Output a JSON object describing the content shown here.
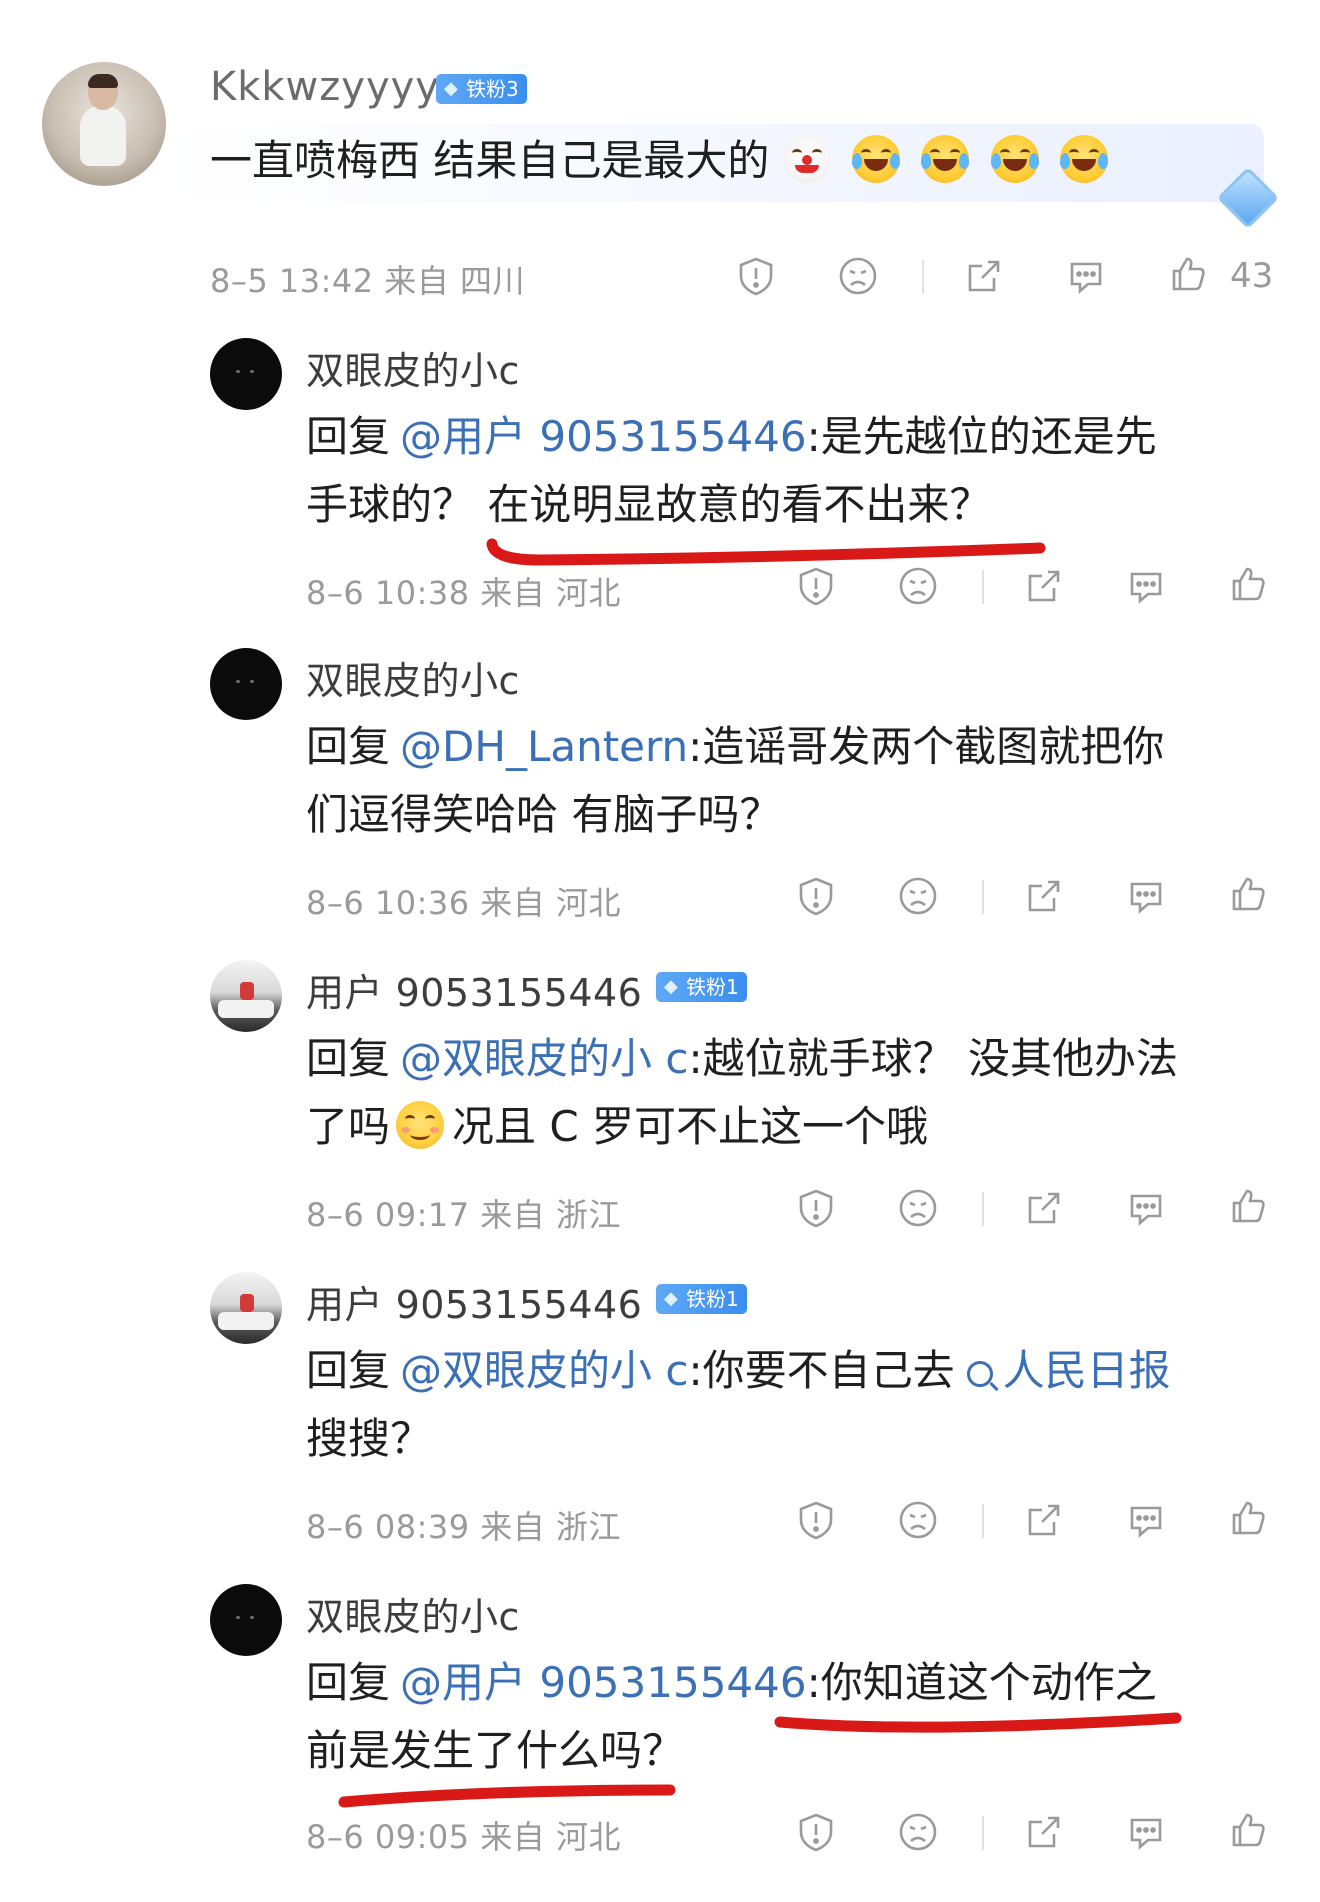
{
  "post": {
    "author": "Kkkwzyyyy",
    "badge": "铁粉3",
    "text": "一直喷梅西 结果自己是最大的",
    "meta": "8–5 13:42 来自 四川",
    "likes": "43",
    "emojis": [
      "clown-face-emoji",
      "laughing-tears-emoji",
      "laughing-tears-emoji",
      "laughing-tears-emoji",
      "laughing-tears-emoji"
    ]
  },
  "replies": [
    {
      "author": "双眼皮的小c",
      "reply_prefix": "回复",
      "mention": "@用户 9053155446",
      "line1_text": ":是先越位的还是先",
      "line2_text": "手球的？ 在说明显故意的看不出来？",
      "meta": "8–6 10:38 来自 河北"
    },
    {
      "author": "双眼皮的小c",
      "reply_prefix": "回复",
      "mention": "@DH_Lantern",
      "line1_text": ":造谣哥发两个截图就把你",
      "line2_text": "们逗得笑哈哈  有脑子吗？",
      "meta": "8–6 10:36 来自 河北"
    },
    {
      "author": "用户 9053155446",
      "badge": "铁粉1",
      "reply_prefix": "回复",
      "mention": "@双眼皮的小 c",
      "line1_text": ":越位就手球？ 没其他办法",
      "line2_a": "了吗",
      "line2_b": "况且 C 罗可不止这一个哦",
      "meta": "8–6 09:17 来自 浙江"
    },
    {
      "author": "用户 9053155446",
      "badge": "铁粉1",
      "reply_prefix": "回复",
      "mention": "@双眼皮的小 c",
      "line1_text": ":你要不自己去",
      "search_link": "人民日报",
      "line2_text": "搜搜？",
      "meta": "8–6 08:39 来自 浙江"
    },
    {
      "author": "双眼皮的小c",
      "reply_prefix": "回复",
      "mention": "@用户 9053155446",
      "line1_text": ":你知道这个动作之",
      "line2_text": "前是发生了什么吗？",
      "meta": "8–6 09:05 来自 河北"
    }
  ],
  "icons": [
    "report-icon",
    "dislike-face-icon",
    "share-icon",
    "comment-icon",
    "like-thumb-icon"
  ],
  "colors": {
    "mention": "#3b6fb6",
    "meta": "#9a9a9a",
    "underline": "#d91818",
    "badge": "#4a9af2"
  }
}
